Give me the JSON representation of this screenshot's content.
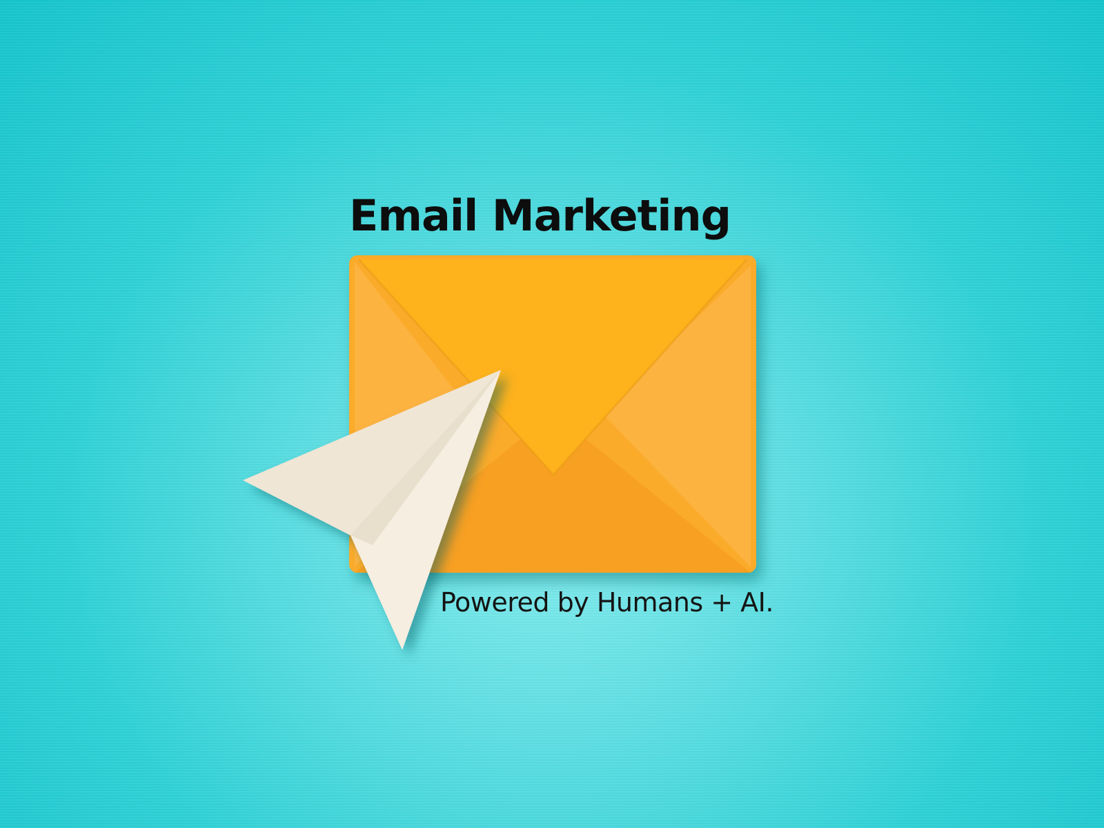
{
  "heading": "Email Marketing",
  "tagline": "Powered by Humans + AI.",
  "icons": {
    "envelope": "envelope-icon",
    "paper_plane": "paper-plane-icon"
  },
  "colors": {
    "background": "#2fd2d7",
    "envelope": "#fbab2a",
    "paper_plane": "#f3ead9",
    "text": "#0d0d0d"
  }
}
